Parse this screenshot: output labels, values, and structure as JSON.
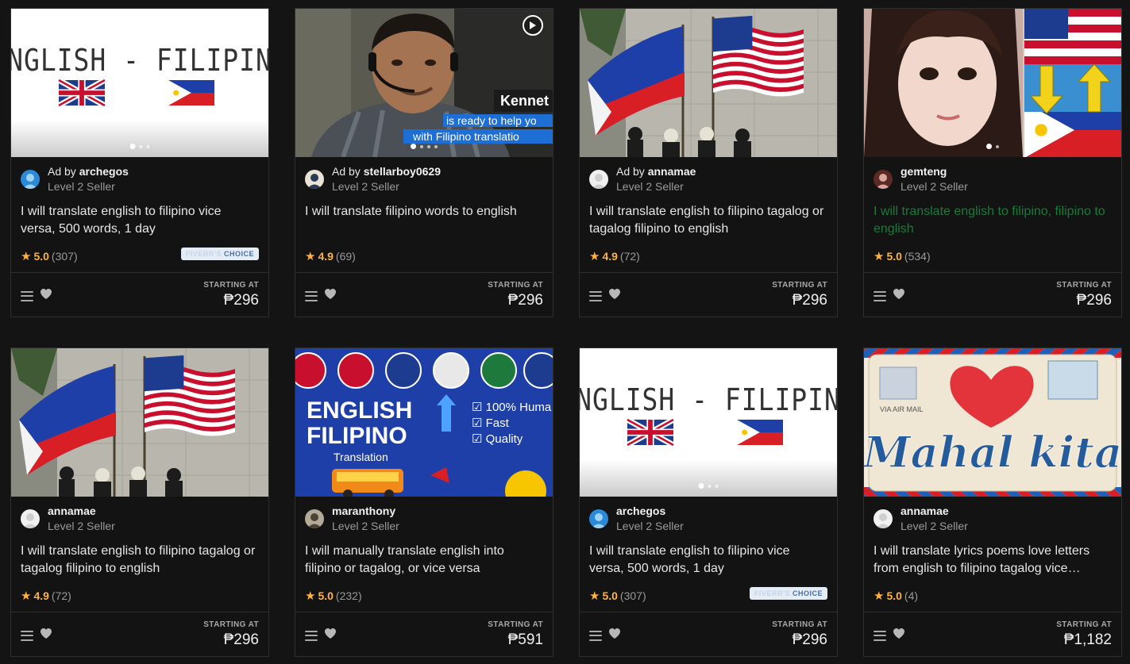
{
  "badge": {
    "prefix": "FIVERR'S",
    "suffix": "CHOICE"
  },
  "footer": {
    "starting_at": "STARTING AT"
  },
  "gigs": [
    {
      "thumb": "english-filipino",
      "ad": true,
      "seller": "archegos",
      "level": "Level 2 Seller",
      "title": "I will translate english to filipino vice versa, 500 words, 1 day",
      "rating": "5.0",
      "reviews": "(307)",
      "choice": true,
      "price": "₱296",
      "visited": false
    },
    {
      "thumb": "video-person",
      "ad": true,
      "seller": "stellarboy0629",
      "level": "Level 2 Seller",
      "title": "I will translate filipino words to english",
      "rating": "4.9",
      "reviews": "(69)",
      "choice": false,
      "price": "₱296",
      "visited": false,
      "overlay": {
        "name": "Kennet",
        "line1": "is ready to help yo",
        "line2": "with Filipino translatio"
      }
    },
    {
      "thumb": "flags-monument",
      "ad": true,
      "seller": "annamae",
      "level": "Level 2 Seller",
      "title": "I will translate english to filipino tagalog or tagalog filipino to english",
      "rating": "4.9",
      "reviews": "(72)",
      "choice": false,
      "price": "₱296",
      "visited": false
    },
    {
      "thumb": "woman-flags",
      "ad": false,
      "seller": "gemteng",
      "level": "Level 2 Seller",
      "title": "I will translate english to filipino, filipino to english",
      "rating": "5.0",
      "reviews": "(534)",
      "choice": false,
      "price": "₱296",
      "visited": true
    },
    {
      "thumb": "flags-monument",
      "ad": false,
      "seller": "annamae",
      "level": "Level 2 Seller",
      "title": "I will translate english to filipino tagalog or tagalog filipino to english",
      "rating": "4.9",
      "reviews": "(72)",
      "choice": false,
      "price": "₱296",
      "visited": false
    },
    {
      "thumb": "english-filipino-blue",
      "ad": false,
      "seller": "maranthony",
      "level": "Level 2 Seller",
      "title": "I will manually translate english into filipino or tagalog, or vice versa",
      "rating": "5.0",
      "reviews": "(232)",
      "choice": false,
      "price": "₱591",
      "visited": false,
      "overlay": {
        "line1": "ENGLISH",
        "line2": "FILIPINO",
        "sub": "Translation",
        "checks": [
          "100% Huma",
          "Fast",
          "Quality"
        ]
      }
    },
    {
      "thumb": "english-filipino",
      "ad": false,
      "seller": "archegos",
      "level": "Level 2 Seller",
      "title": "I will translate english to filipino vice versa, 500 words, 1 day",
      "rating": "5.0",
      "reviews": "(307)",
      "choice": true,
      "price": "₱296",
      "visited": false
    },
    {
      "thumb": "mahal-kita",
      "ad": false,
      "seller": "annamae",
      "level": "Level 2 Seller",
      "title": "I will translate lyrics poems love letters from english to filipino tagalog vice…",
      "rating": "5.0",
      "reviews": "(4)",
      "choice": false,
      "price": "₱1,182",
      "visited": false,
      "overlay": {
        "text": "Mahal kita",
        "stamp": "VIA AIR MAIL"
      }
    }
  ],
  "thumb_labels": {
    "english_filipino": "ENGLISH - FILIPINO"
  },
  "ad_prefix": "Ad by",
  "icons": {
    "menu": "list-icon",
    "heart": "heart-icon",
    "star": "star-icon",
    "play": "play-icon"
  }
}
